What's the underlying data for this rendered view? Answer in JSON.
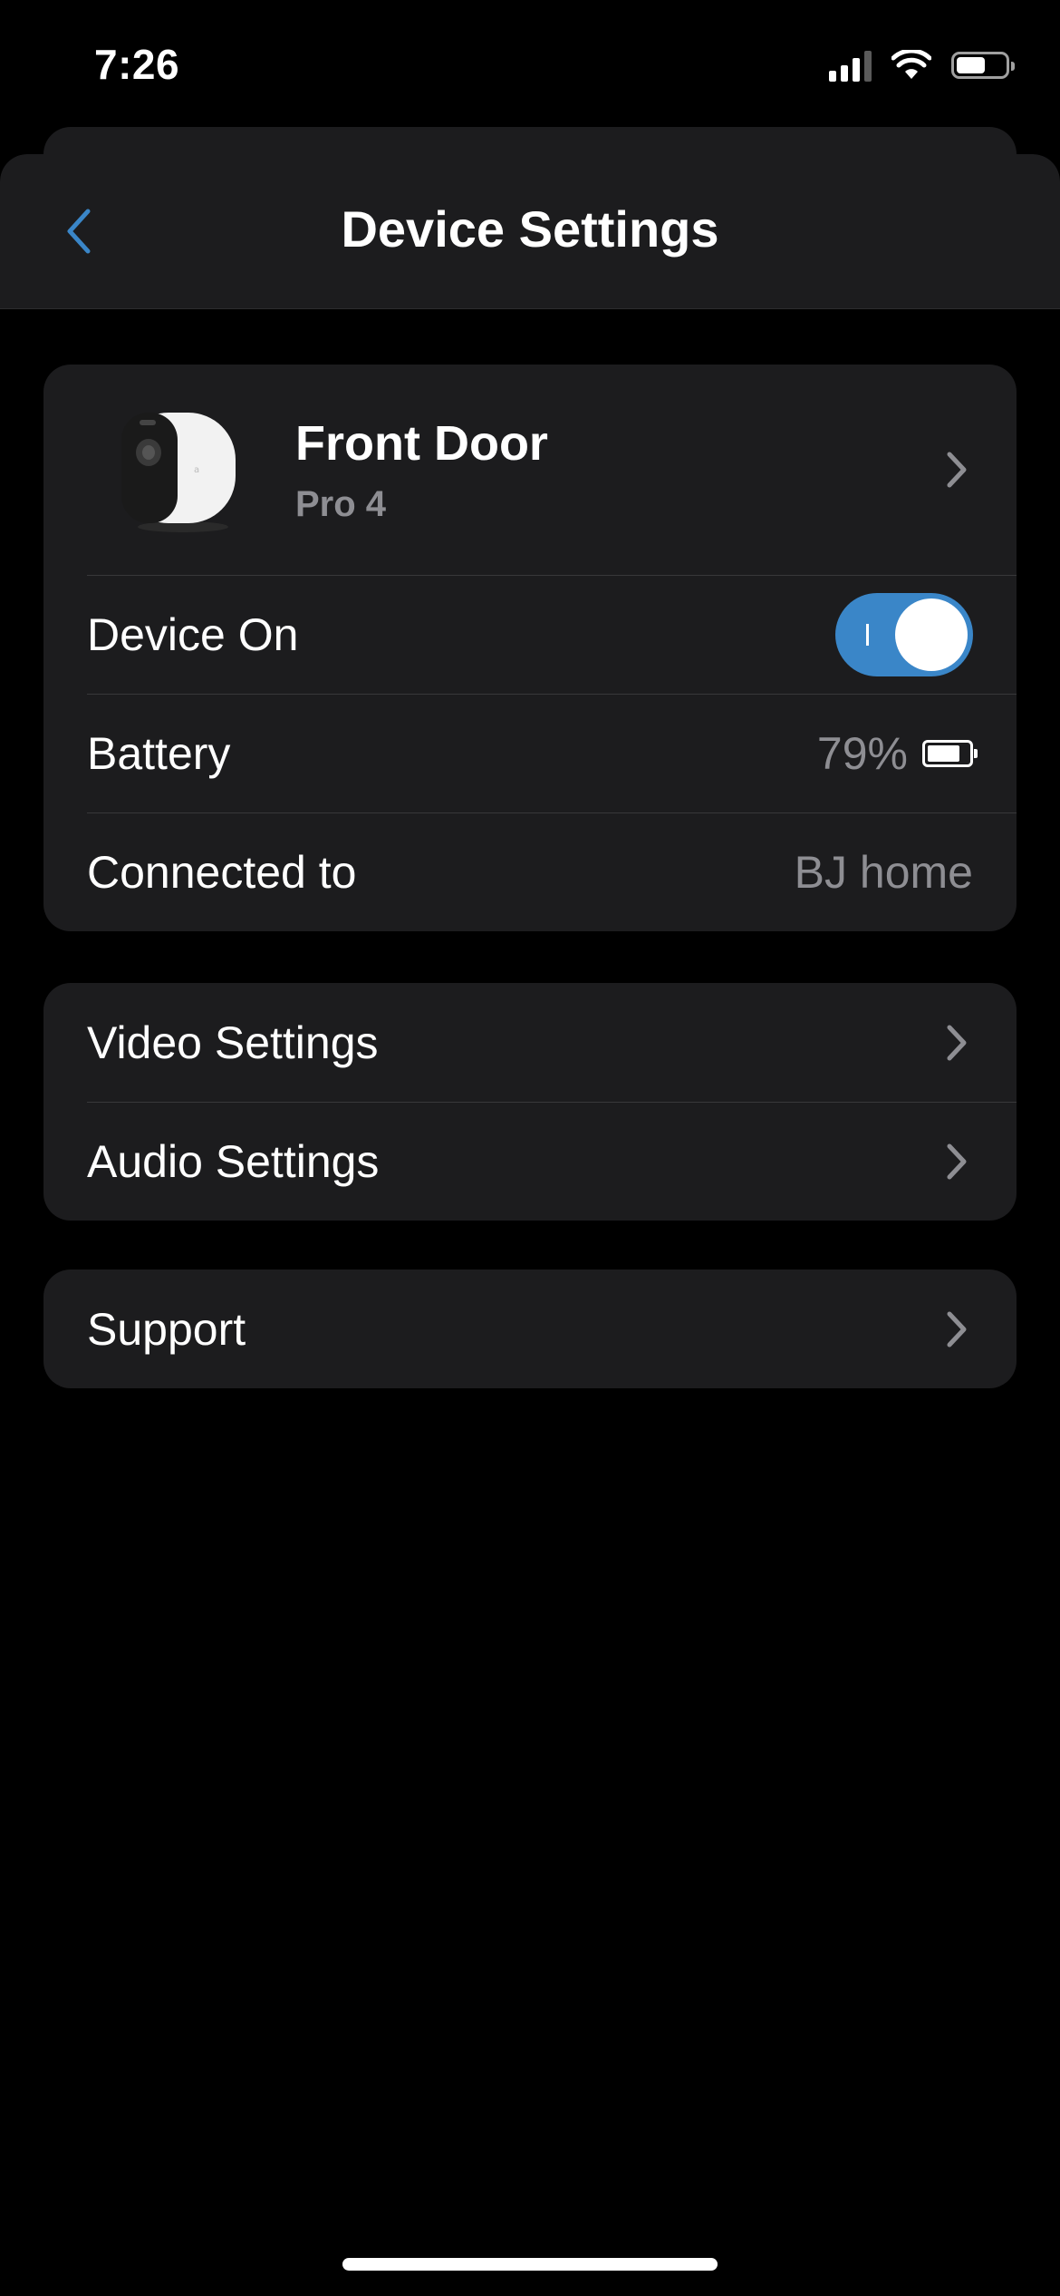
{
  "status_bar": {
    "time": "7:26",
    "signal_bars_active": 3,
    "signal_bars_total": 4,
    "battery_level": 0.6
  },
  "nav": {
    "title": "Device Settings",
    "back_icon": "chevron-left-icon",
    "accent_color": "#3a86c8"
  },
  "device": {
    "name": "Front Door",
    "model": "Pro 4",
    "image_icon": "camera-icon"
  },
  "device_on": {
    "label": "Device On",
    "value": true
  },
  "battery": {
    "label": "Battery",
    "value": "79%",
    "level": 0.79
  },
  "connection": {
    "label": "Connected to",
    "value": "BJ home"
  },
  "settings": {
    "items": [
      {
        "label": "Video Settings"
      },
      {
        "label": "Audio Settings"
      }
    ]
  },
  "support": {
    "label": "Support"
  }
}
